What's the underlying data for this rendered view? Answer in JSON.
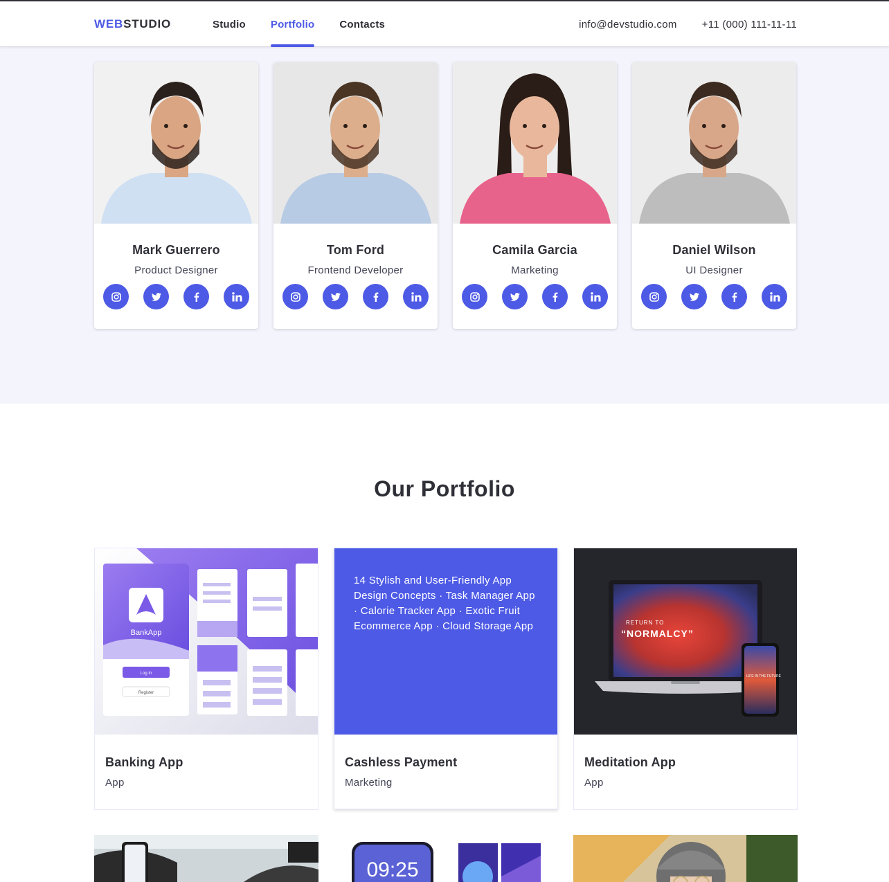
{
  "header": {
    "logo_accent": "WEB",
    "logo_rest": "STUDIO",
    "nav": [
      "Studio",
      "Portfolio",
      "Contacts"
    ],
    "active_nav": "Portfolio",
    "email": "info@devstudio.com",
    "phone": "+11 (000) 111-11-11"
  },
  "team": [
    {
      "name": "Mark Guerrero",
      "role": "Product Designer"
    },
    {
      "name": "Tom Ford",
      "role": "Frontend Developer"
    },
    {
      "name": "Camila Garcia",
      "role": "Marketing"
    },
    {
      "name": "Daniel Wilson",
      "role": "UI Designer"
    }
  ],
  "social_icons": [
    "instagram-icon",
    "twitter-icon",
    "facebook-icon",
    "linkedin-icon"
  ],
  "portfolio": {
    "title": "Our Portfolio",
    "items": [
      {
        "title": "Banking App",
        "category": "App"
      },
      {
        "title": "Cashless Payment",
        "category": "Marketing",
        "overlay_text": "14 Stylish and User-Friendly App Design Concepts · Task Manager App · Calorie Tracker App · Exotic Fruit Ecommerce App · Cloud Storage App"
      },
      {
        "title": "Meditation App",
        "category": "App"
      }
    ],
    "bank_app_label": "BankApp",
    "bank_login": "Log In",
    "bank_register": "Register",
    "normalcy_small": "RETURN TO",
    "normalcy_big": "“NORMALCY”",
    "phone_text": "LIFE IN THE FUTURE",
    "clock": "09:25"
  },
  "colors": {
    "accent": "#4d5ae5",
    "text": "#2f2f37",
    "team_bg": "#f4f4fd"
  }
}
